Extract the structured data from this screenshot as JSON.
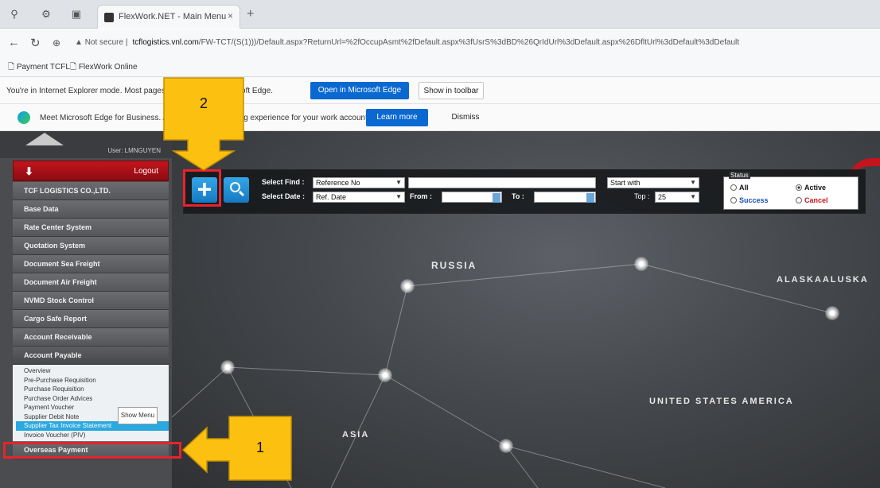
{
  "browser": {
    "tab_title": "FlexWork.NET - Main Menu",
    "address_warning": "Not secure",
    "url_host": "tcflogistics.vnl.com",
    "url_rest": "/FW-TCT/(S(1)))/Default.aspx?ReturnUrl=%2fOccupAsmt%2fDefault.aspx%3fUsrS%3dBD%26QrIdUrl%3dDefault.aspx%26DfltUrl%3dDefault%3dDefault",
    "favorites": [
      "Payment TCFL",
      "FlexWork Online"
    ],
    "ie_mode_msg": "You're in Internet Explorer mode. Most pages work better in Microsoft Edge.",
    "open_edge_label": "Open in Microsoft Edge",
    "show_toolbar_label": "Show in toolbar",
    "business_msg": "Meet Microsoft Edge for Business. A more secure browsing experience for your work account.",
    "learn_more_label": "Learn more",
    "dismiss_label": "Dismiss"
  },
  "app": {
    "user_label": "User: LMNGUYEN",
    "logout_label": "Logout",
    "menu": [
      "TCF LOGISTICS CO.,LTD.",
      "Base Data",
      "Rate Center System",
      "Quotation System",
      "Document Sea Freight",
      "Document Air Freight",
      "NVMD Stock Control",
      "Cargo Safe Report",
      "Account Receivable",
      "Account Payable"
    ],
    "submenu": [
      "Overview",
      "Pre-Purchase Requisition",
      "Purchase Requisition",
      "Purchase Order Advices",
      "Payment Voucher",
      "Supplier Debit Note",
      "Supplier Tax Invoice Statement",
      "Invoice Voucher (PIV)"
    ],
    "last_menu": "Overseas Payment",
    "show_menu_label": "Show Menu",
    "search": {
      "select_find_label": "Select Find :",
      "select_find_value": "Reference No",
      "select_date_label": "Select Date :",
      "select_date_value": "Ref. Date",
      "from_label": "From :",
      "to_label": "To :",
      "match_value": "Start with",
      "top_label": "Top :",
      "top_value": "25",
      "status_legend": "Status",
      "status_options": [
        "All",
        "Active",
        "Success",
        "Cancel"
      ]
    },
    "map_labels": [
      "RUSSIA",
      "ALASKA",
      "ALUSKA",
      "UNITED STATES AMERICA",
      "ASIA"
    ]
  },
  "annotations": {
    "callout1": "1",
    "callout2": "2"
  }
}
